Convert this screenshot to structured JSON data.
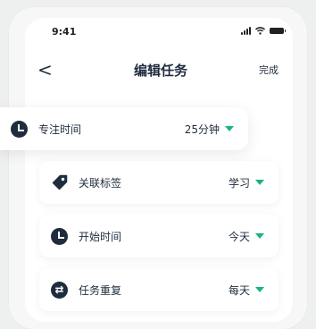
{
  "status_bar": {
    "time": "9:41"
  },
  "nav": {
    "back_symbol": "<",
    "title": "编辑任务",
    "done_label": "完成"
  },
  "rows": [
    {
      "label": "专注时间",
      "value": "25分钟",
      "icon": "clock-icon"
    },
    {
      "label": "关联标签",
      "value": "学习",
      "icon": "tag-icon"
    },
    {
      "label": "开始时间",
      "value": "今天",
      "icon": "clock-icon"
    },
    {
      "label": "任务重复",
      "value": "每天",
      "icon": "repeat-icon"
    }
  ],
  "colors": {
    "accent": "#19b383",
    "text": "#1f2c3d",
    "background": "#eef0ef"
  }
}
